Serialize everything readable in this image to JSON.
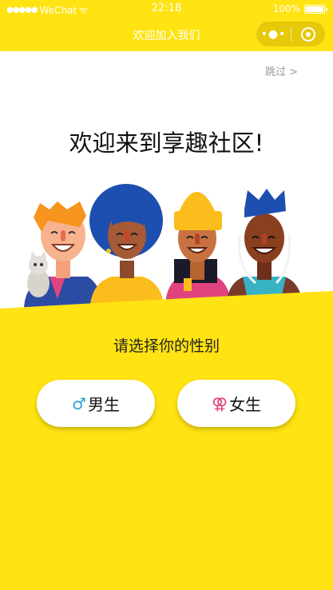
{
  "status_bar": {
    "signal": "●●●●●",
    "carrier": "WeChat",
    "wifi": "ᯤ",
    "time": "22:18",
    "battery": "100%"
  },
  "nav": {
    "title": "欢迎加入我们",
    "more_icon": "•●•"
  },
  "page": {
    "skip": "跳过 >",
    "welcome": "欢迎来到享趣社区!",
    "prompt": "请选择你的性别",
    "male_symbol": "♂",
    "male_label": "男生",
    "female_symbol": "⚢",
    "female_label": "女生"
  },
  "colors": {
    "accent": "#ffe312",
    "male": "#2aa2d8",
    "female": "#e0447e"
  }
}
